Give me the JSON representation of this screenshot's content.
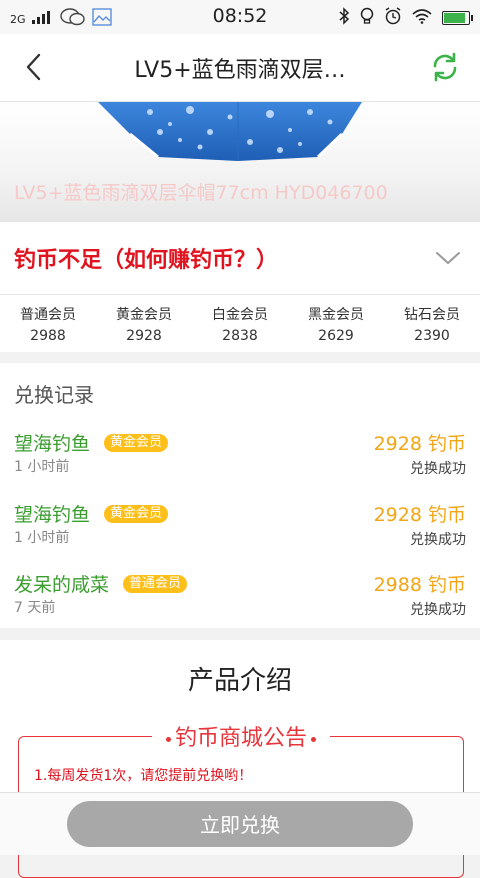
{
  "status_bar": {
    "network": "2G",
    "time": "08:52",
    "icons": [
      "signal-icon",
      "wechat-icon",
      "gallery-icon",
      "bluetooth-icon",
      "bulb-icon",
      "alarm-icon",
      "wifi-icon",
      "battery-icon"
    ]
  },
  "navbar": {
    "title": "LV5+蓝色雨滴双层…",
    "back_icon": "chevron-left-icon",
    "refresh_icon": "refresh-icon",
    "accent": "#3cb34a"
  },
  "product": {
    "caption": "LV5+蓝色雨滴双层伞帽77cm HYD046700",
    "image_color": "#2f73c9"
  },
  "coins_notice": {
    "text": "钓币不足（如何赚钓币？）",
    "color": "#e0131f",
    "chevron_icon": "chevron-down-icon"
  },
  "member_prices": [
    {
      "level": "普通会员",
      "price": "2988"
    },
    {
      "level": "黄金会员",
      "price": "2928"
    },
    {
      "level": "白金会员",
      "price": "2838"
    },
    {
      "level": "黑金会员",
      "price": "2629"
    },
    {
      "level": "钻石会员",
      "price": "2390"
    }
  ],
  "records": {
    "title": "兑换记录",
    "items": [
      {
        "name": "望海钓鱼",
        "badge": "黄金会员",
        "time": "1 小时前",
        "amount": "2928 钓币",
        "status": "兑换成功"
      },
      {
        "name": "望海钓鱼",
        "badge": "黄金会员",
        "time": "1 小时前",
        "amount": "2928 钓币",
        "status": "兑换成功"
      },
      {
        "name": "发呆的咸菜",
        "badge": "普通会员",
        "time": "7 天前",
        "amount": "2988 钓币",
        "status": "兑换成功"
      }
    ]
  },
  "intro": {
    "title": "产品介绍",
    "notice_title": "钓币商城公告",
    "notice_lines": [
      "1.每周发货1次，请您提前兑换哟！"
    ]
  },
  "bottom": {
    "button_label": "立即兑换",
    "button_color": "#a8a8a8"
  }
}
